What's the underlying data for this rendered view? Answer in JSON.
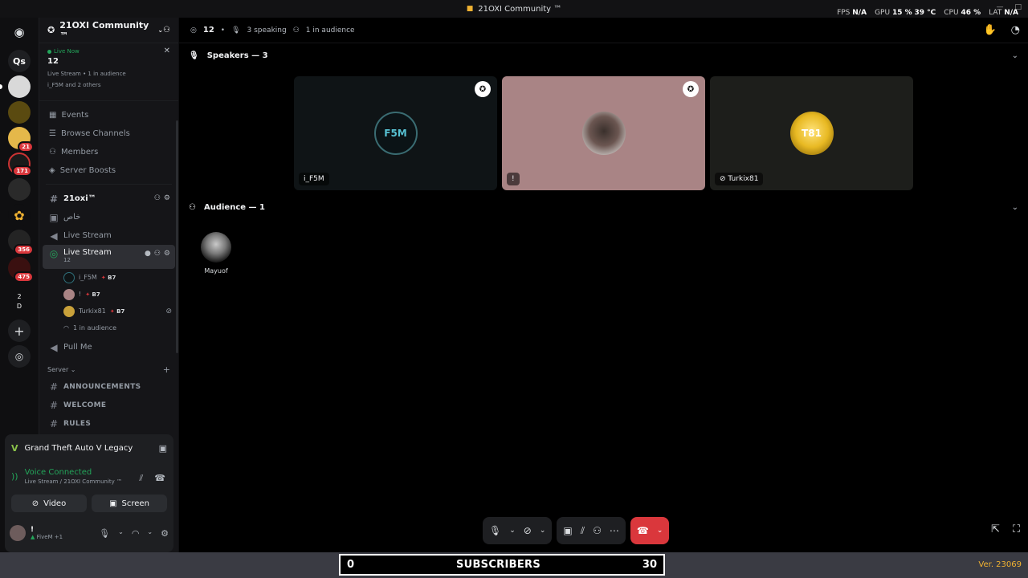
{
  "window": {
    "title": "21OXI Community ™"
  },
  "perf_overlay": {
    "fps_label": "FPS",
    "fps_value": "N/A",
    "gpu_label": "GPU",
    "gpu_value": "15 %",
    "gpu_temp": "39 °C",
    "cpu_label": "CPU",
    "cpu_value": "46 %",
    "lat_label": "LAT",
    "lat_value": "N/A"
  },
  "rail": {
    "home_icon": "discord-logo-icon",
    "items": [
      {
        "label": "Qs"
      },
      {
        "badge": ""
      },
      {
        "badge": ""
      },
      {
        "badge": "21"
      },
      {
        "badge": "171"
      },
      {
        "badge": ""
      },
      {
        "badge": ""
      },
      {
        "badge": "356"
      },
      {
        "badge": "475"
      },
      {
        "label_top": "2",
        "label_bottom": "D"
      }
    ],
    "add_icon": "plus-icon",
    "discover_icon": "compass-icon"
  },
  "sidebar": {
    "server_name": "21OXI Community ™",
    "live": {
      "badge": "Live Now",
      "title": "12",
      "sub": "Live Stream • 1 in audience",
      "users": "i_F5M and 2 others"
    },
    "menu": [
      "Events",
      "Browse Channels",
      "Members",
      "Server Boosts"
    ],
    "channels": {
      "text1": "21oxi™",
      "text2": "خاص",
      "voice1": "Live Stream",
      "active": {
        "name": "Live Stream",
        "topic": "12"
      },
      "users": [
        {
          "name": "i_F5M",
          "tag": "B7"
        },
        {
          "name": "!",
          "tag": "B7"
        },
        {
          "name": "Turkix81",
          "tag": "B7"
        }
      ],
      "audience": "1 in audience",
      "voice2": "Pull Me"
    },
    "category": "Server",
    "cat_channels": [
      "Announcements",
      "WELCOME",
      "RULES"
    ]
  },
  "activity": {
    "game": "Grand Theft Auto V Legacy"
  },
  "voice": {
    "status": "Voice Connected",
    "location": "Live Stream / 21OXI Community ™",
    "video_label": "Video",
    "screen_label": "Screen"
  },
  "user": {
    "name": "!",
    "status": "FiveM +1"
  },
  "stage": {
    "listeners": "12",
    "speaking": "3 speaking",
    "audience_count": "1 in audience",
    "speakers_heading": "Speakers — 3",
    "audience_heading": "Audience — 1",
    "speakers": [
      {
        "name": "i_F5M",
        "avatar_text": "F5M",
        "bg": "#0f1416"
      },
      {
        "name": "!",
        "avatar_text": "",
        "bg": "#a98485"
      },
      {
        "name": "Turkix81",
        "avatar_text": "T81",
        "bg": "#1d1e1b"
      }
    ],
    "audience": [
      {
        "name": "Mayuof"
      }
    ]
  },
  "banner": {
    "left_value": "0",
    "label": "SUBSCRIBERS",
    "right_value": "30",
    "version": "Ver. 23069"
  },
  "colors": {
    "accent_green": "#23a55a",
    "danger": "#da373c",
    "version": "#f0b232"
  }
}
